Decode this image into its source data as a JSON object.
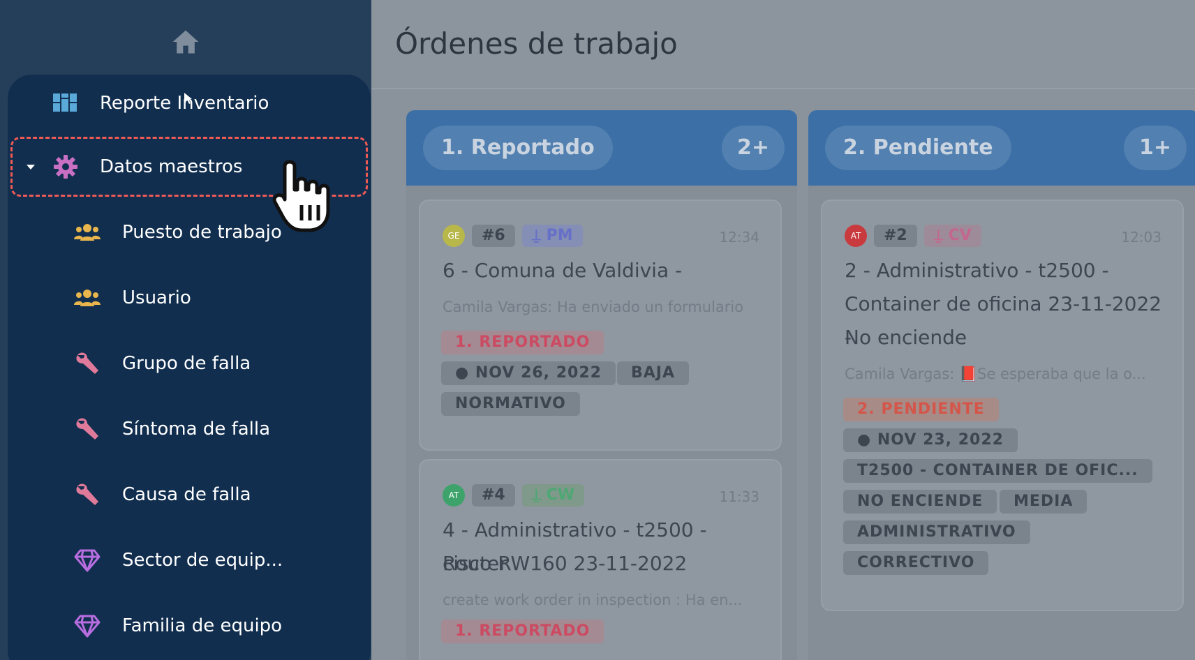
{
  "sidebar": {
    "items": [
      {
        "label": "Reporte Inventario",
        "icon": "dashboard-icon",
        "level": "top"
      },
      {
        "label": "Datos maestros",
        "icon": "gear-icon",
        "level": "top",
        "expanded": true,
        "highlighted": true
      },
      {
        "label": "Puesto de trabajo",
        "icon": "group-icon",
        "level": "sub"
      },
      {
        "label": "Usuario",
        "icon": "group-icon",
        "level": "sub"
      },
      {
        "label": "Grupo de falla",
        "icon": "wrench-icon",
        "level": "sub"
      },
      {
        "label": "Síntoma de falla",
        "icon": "wrench-icon",
        "level": "sub"
      },
      {
        "label": "Causa de falla",
        "icon": "wrench-icon",
        "level": "sub"
      },
      {
        "label": "Sector de equip...",
        "icon": "diamond-icon",
        "level": "sub"
      },
      {
        "label": "Familia de equipo",
        "icon": "diamond-icon",
        "level": "sub"
      }
    ]
  },
  "page": {
    "title": "Órdenes de trabajo"
  },
  "columns": [
    {
      "title": "1. Reportado",
      "count": "2+",
      "cards": [
        {
          "avatar": "GE",
          "avatar_color": "#b8b74a",
          "id": "#6",
          "user": "PM",
          "time": "12:34",
          "title": "6 - Comuna de Valdivia -",
          "subtitle": "Camila Vargas: Ha enviado un formulario",
          "status": "1. REPORTADO",
          "date": "NOV 26, 2022",
          "priority": "BAJA",
          "tags": [
            "NORMATIVO"
          ]
        },
        {
          "avatar": "AT",
          "avatar_color": "#3da36a",
          "id": "#4",
          "user": "CW",
          "time": "11:33",
          "title_line1": "4 - Administrativo - t2500 - Router",
          "title_line2": "cisco RW160 23-11-2022",
          "subtitle": "create work order in inspection : Ha en...",
          "status": "1. REPORTADO"
        }
      ]
    },
    {
      "title": "2. Pendiente",
      "count": "1+",
      "cards": [
        {
          "avatar": "AT",
          "avatar_color": "#c83a3e",
          "id": "#2",
          "user": "CV",
          "time": "12:03",
          "title_line1": "2 - Administrativo - t2500 -",
          "title_line2": "Container de oficina 23-11-2022 -",
          "title_line3": "No enciende",
          "subtitle": "Camila Vargas: 📕Se esperaba que la o...",
          "status": "2. PENDIENTE",
          "date": "NOV 23, 2022",
          "tags": [
            "T2500 - CONTAINER DE OFIC...",
            "NO ENCIENDE",
            "MEDIA",
            "ADMINISTRATIVO",
            "CORRECTIVO"
          ]
        }
      ]
    }
  ],
  "colors": {
    "nav_bg": "#253f5a",
    "nav_panel": "#112e4f",
    "highlight_border": "#ef5a55",
    "column_header": "#3b6fa6"
  }
}
